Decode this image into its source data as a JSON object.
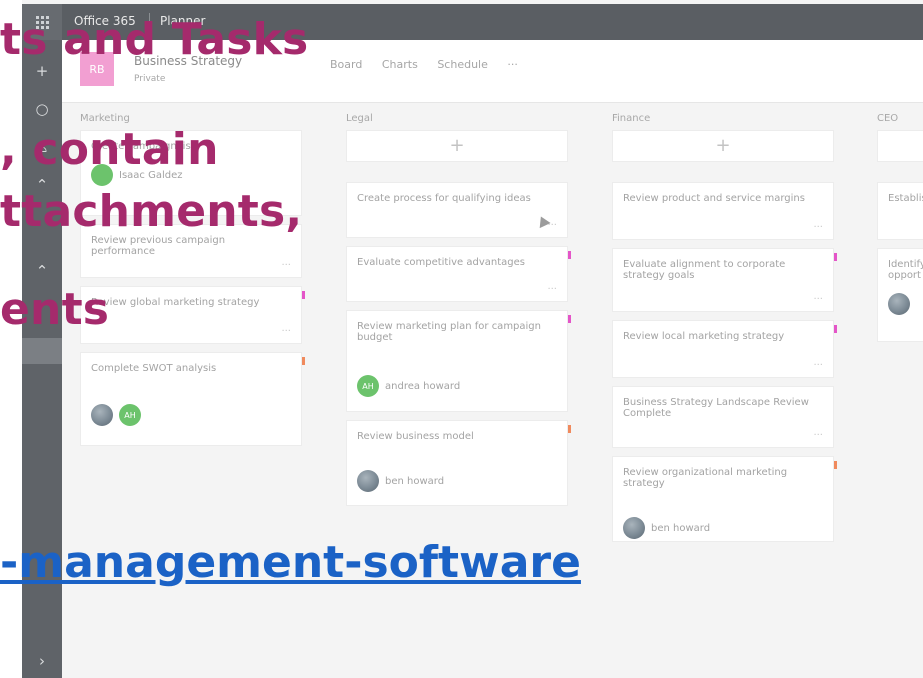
{
  "topbar": {
    "app_name": "Office 365",
    "product": "Planner"
  },
  "rail": {
    "icons": [
      "plus-icon",
      "circle-icon",
      "person-icon",
      "chevron-up-icon",
      "chevron-up-icon",
      "chevron-right-icon"
    ]
  },
  "plan": {
    "avatar_text": "RB",
    "title": "Business Strategy",
    "private_label": "Private",
    "tabs": [
      "Board",
      "Charts",
      "Schedule",
      "···"
    ]
  },
  "columns": [
    {
      "title": "Marketing",
      "cards": [
        {
          "title": "Create campaign list",
          "assignee": "Isaac Galdez",
          "flag": ""
        },
        {
          "title": "Review previous campaign performance",
          "flag": ""
        },
        {
          "title": "Review global marketing strategy",
          "flag": "#e455c8"
        },
        {
          "title": "Complete SWOT analysis",
          "flag": "#f08a5d"
        }
      ]
    },
    {
      "title": "Legal",
      "cards": [
        {
          "title": "Create process for qualifying ideas",
          "flag": ""
        },
        {
          "title": "Evaluate competitive advantages",
          "flag": "#e455c8"
        },
        {
          "title": "Review marketing plan for campaign budget",
          "assignee": "andrea howard",
          "avatar_initials": "AH",
          "flag": "#e455c8"
        },
        {
          "title": "Review business model",
          "assignee": "ben howard",
          "flag": "#f08a5d"
        }
      ]
    },
    {
      "title": "Finance",
      "cards": [
        {
          "title": "Review product and service margins",
          "flag": ""
        },
        {
          "title": "Evaluate alignment to corporate strategy goals",
          "flag": "#e455c8"
        },
        {
          "title": "Review local marketing strategy",
          "flag": "#e455c8"
        },
        {
          "title": "Business Strategy Landscape Review Complete",
          "flag": ""
        },
        {
          "title": "Review organizational marketing strategy",
          "assignee": "ben howard",
          "flag": "#f08a5d"
        }
      ]
    },
    {
      "title": "CEO",
      "cards": [
        {
          "title": "Establis",
          "flag": ""
        },
        {
          "title": "Identify opport",
          "flag": ""
        }
      ]
    }
  ],
  "overlay": {
    "line1": "ts and Tasks",
    "line2": ", contain",
    "line3": "ttachments,",
    "line4": "ents",
    "link": "-management-software"
  },
  "colors": {
    "headline": "#a52a6c",
    "link": "#1b62c6",
    "topbar": "#5a5e63"
  }
}
